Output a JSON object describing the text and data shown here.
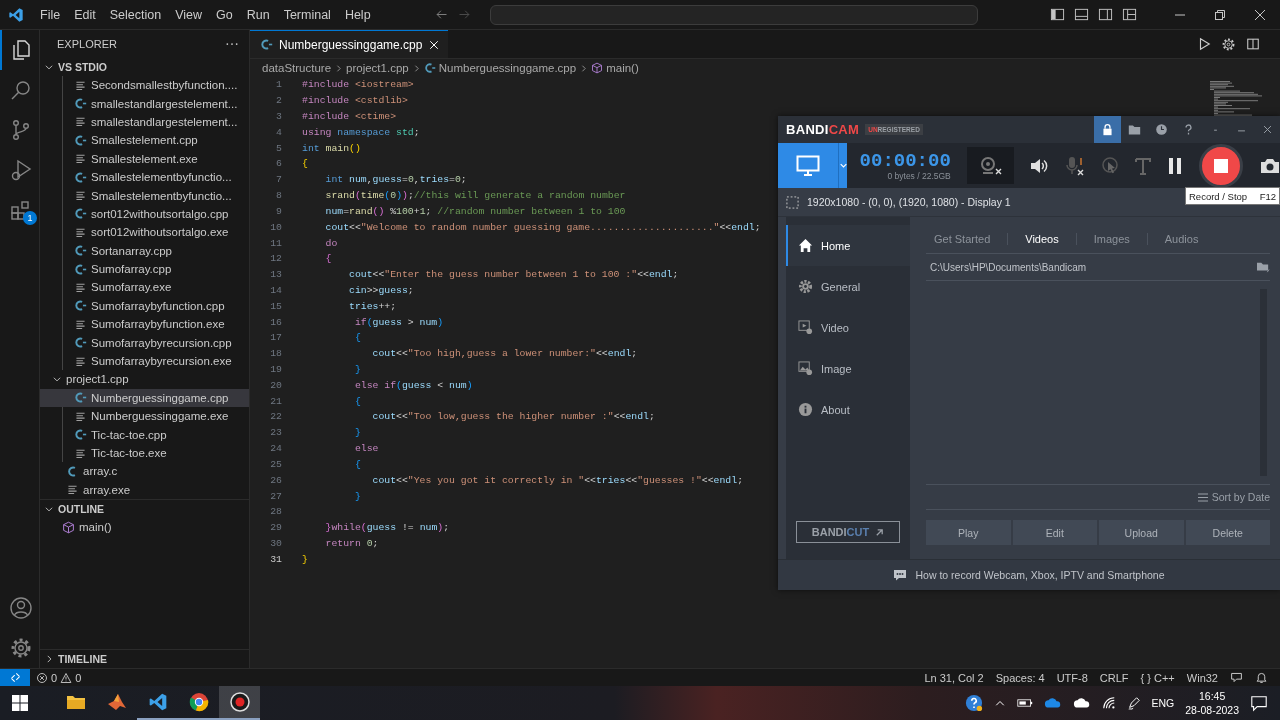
{
  "menu": [
    "File",
    "Edit",
    "Selection",
    "View",
    "Go",
    "Run",
    "Terminal",
    "Help"
  ],
  "activity_bar": {
    "items": [
      {
        "kind": "explorer",
        "selected": true
      },
      {
        "kind": "search",
        "selected": false
      },
      {
        "kind": "source-control",
        "selected": false
      },
      {
        "kind": "run-debug",
        "selected": false
      },
      {
        "kind": "extensions",
        "selected": false,
        "badge": "1"
      }
    ]
  },
  "sidebar": {
    "title": "EXPLORER",
    "workspace": {
      "label": "VS STDIO",
      "expanded": true,
      "children": [
        {
          "kind": "folder",
          "expanded": true,
          "children": [
            {
              "label": "Secondsmallestbyfunction....",
              "kind": "exe",
              "selected": false
            },
            {
              "label": "smallestandlargestelement...",
              "kind": "cpp",
              "selected": false
            },
            {
              "label": "smallestandlargestelement...",
              "kind": "exe",
              "selected": false
            },
            {
              "label": "Smallestelement.cpp",
              "kind": "cpp",
              "selected": false
            },
            {
              "label": "Smallestelement.exe",
              "kind": "exe",
              "selected": false
            },
            {
              "label": "Smallestelementbyfunctio...",
              "kind": "cpp",
              "selected": false
            },
            {
              "label": "Smallestelementbyfunctio...",
              "kind": "exe",
              "selected": false
            },
            {
              "label": "sort012withoutsortalgo.cpp",
              "kind": "cpp",
              "selected": false
            },
            {
              "label": "sort012withoutsortalgo.exe",
              "kind": "exe",
              "selected": false
            },
            {
              "label": "Sortanarray.cpp",
              "kind": "cpp",
              "selected": false
            },
            {
              "label": "Sumofarray.cpp",
              "kind": "cpp",
              "selected": false
            },
            {
              "label": "Sumofarray.exe",
              "kind": "exe",
              "selected": false
            },
            {
              "label": "Sumofarraybyfunction.cpp",
              "kind": "cpp",
              "selected": false
            },
            {
              "label": "Sumofarraybyfunction.exe",
              "kind": "exe",
              "selected": false
            },
            {
              "label": "Sumofarraybyrecursion.cpp",
              "kind": "cpp",
              "selected": false
            },
            {
              "label": "Sumofarraybyrecursion.exe",
              "kind": "exe",
              "selected": false
            }
          ]
        },
        {
          "label": "project1.cpp",
          "kind": "folder",
          "expanded": true,
          "children": [
            {
              "label": "Numberguessinggame.cpp",
              "kind": "cpp",
              "selected": true
            },
            {
              "label": "Numberguessinggame.exe",
              "kind": "exe",
              "selected": false
            },
            {
              "label": "Tic-tac-toe.cpp",
              "kind": "cpp",
              "selected": false
            },
            {
              "label": "Tic-tac-toe.exe",
              "kind": "exe",
              "selected": false
            }
          ]
        },
        {
          "label": "array.c",
          "kind": "c",
          "selected": false
        },
        {
          "label": "array.exe",
          "kind": "exe",
          "selected": false
        }
      ]
    },
    "outline": {
      "label": "OUTLINE",
      "expanded": true,
      "children": [
        {
          "label": "main()"
        }
      ]
    },
    "timeline": {
      "label": "TIMELINE",
      "expanded": false
    }
  },
  "editor": {
    "tabs": [
      {
        "label": "Numberguessinggame.cpp",
        "selected": true
      }
    ],
    "breadcrumb": [
      {
        "label": "dataStructure",
        "kind": "folder"
      },
      {
        "label": "project1.cpp",
        "kind": "folder"
      },
      {
        "label": "Numberguessinggame.cpp",
        "kind": "cpp"
      },
      {
        "label": "main()",
        "kind": "function"
      }
    ],
    "lines": [
      {
        "number": "1",
        "current": false,
        "tokens": [
          {
            "kind": "directive",
            "text": "#include"
          },
          {
            "kind": "string",
            "text": " <iostream>"
          }
        ]
      },
      {
        "number": "2",
        "current": false,
        "tokens": [
          {
            "kind": "directive",
            "text": "#include"
          },
          {
            "kind": "string",
            "text": " <cstdlib>"
          }
        ]
      },
      {
        "number": "3",
        "current": false,
        "tokens": [
          {
            "kind": "directive",
            "text": "#include"
          },
          {
            "kind": "string",
            "text": " <ctime>"
          }
        ]
      },
      {
        "number": "4",
        "current": false,
        "tokens": [
          {
            "kind": "directive",
            "text": "using"
          },
          {
            "kind": "keyword",
            "text": " namespace"
          },
          {
            "kind": "type",
            "text": " std"
          },
          {
            "kind": "plain",
            "text": ";"
          }
        ]
      },
      {
        "number": "5",
        "current": false,
        "tokens": [
          {
            "kind": "keyword",
            "text": "int"
          },
          {
            "kind": "function",
            "text": " main"
          },
          {
            "kind": "bracket1",
            "text": "()"
          }
        ]
      },
      {
        "number": "6",
        "current": false,
        "tokens": [
          {
            "kind": "bracket1",
            "text": "{"
          }
        ]
      },
      {
        "number": "7",
        "current": false,
        "tokens": [
          {
            "kind": "keyword",
            "text": "    int"
          },
          {
            "kind": "variable",
            "text": " num"
          },
          {
            "kind": "plain",
            "text": ","
          },
          {
            "kind": "variable",
            "text": "guess"
          },
          {
            "kind": "plain",
            "text": "="
          },
          {
            "kind": "number",
            "text": "0"
          },
          {
            "kind": "plain",
            "text": ","
          },
          {
            "kind": "variable",
            "text": "tries"
          },
          {
            "kind": "plain",
            "text": "="
          },
          {
            "kind": "number",
            "text": "0"
          },
          {
            "kind": "plain",
            "text": ";"
          }
        ]
      },
      {
        "number": "8",
        "current": false,
        "tokens": [
          {
            "kind": "function",
            "text": "    srand"
          },
          {
            "kind": "bracket2",
            "text": "("
          },
          {
            "kind": "function",
            "text": "time"
          },
          {
            "kind": "bracket3",
            "text": "("
          },
          {
            "kind": "number",
            "text": "0"
          },
          {
            "kind": "bracket3",
            "text": ")"
          },
          {
            "kind": "bracket2",
            "text": ")"
          },
          {
            "kind": "plain",
            "text": ";"
          },
          {
            "kind": "comment",
            "text": "//this will generate a random number"
          }
        ]
      },
      {
        "number": "9",
        "current": false,
        "tokens": [
          {
            "kind": "variable",
            "text": "    num"
          },
          {
            "kind": "plain",
            "text": "="
          },
          {
            "kind": "function",
            "text": "rand"
          },
          {
            "kind": "bracket2",
            "text": "()"
          },
          {
            "kind": "plain",
            "text": " %"
          },
          {
            "kind": "number",
            "text": "100"
          },
          {
            "kind": "plain",
            "text": "+"
          },
          {
            "kind": "number",
            "text": "1"
          },
          {
            "kind": "plain",
            "text": "; "
          },
          {
            "kind": "comment",
            "text": "//random number between 1 to 100"
          }
        ]
      },
      {
        "number": "10",
        "current": false,
        "tokens": [
          {
            "kind": "variable",
            "text": "    cout"
          },
          {
            "kind": "plain",
            "text": "<<"
          },
          {
            "kind": "string",
            "text": "\"Welcome to random number guessing game.....................\""
          },
          {
            "kind": "plain",
            "text": "<<"
          },
          {
            "kind": "variable",
            "text": "endl"
          },
          {
            "kind": "plain",
            "text": ";"
          }
        ]
      },
      {
        "number": "11",
        "current": false,
        "tokens": [
          {
            "kind": "directive",
            "text": "    do"
          }
        ]
      },
      {
        "number": "12",
        "current": false,
        "tokens": [
          {
            "kind": "bracket2",
            "text": "    {"
          }
        ]
      },
      {
        "number": "13",
        "current": false,
        "tokens": [
          {
            "kind": "variable",
            "text": "        cout"
          },
          {
            "kind": "plain",
            "text": "<<"
          },
          {
            "kind": "string",
            "text": "\"Enter the guess number between 1 to 100 :\""
          },
          {
            "kind": "plain",
            "text": "<<"
          },
          {
            "kind": "variable",
            "text": "endl"
          },
          {
            "kind": "plain",
            "text": ";"
          }
        ]
      },
      {
        "number": "14",
        "current": false,
        "tokens": [
          {
            "kind": "variable",
            "text": "        cin"
          },
          {
            "kind": "plain",
            "text": ">>"
          },
          {
            "kind": "variable",
            "text": "guess"
          },
          {
            "kind": "plain",
            "text": ";"
          }
        ]
      },
      {
        "number": "15",
        "current": false,
        "tokens": [
          {
            "kind": "variable",
            "text": "        tries"
          },
          {
            "kind": "plain",
            "text": "++;"
          }
        ]
      },
      {
        "number": "16",
        "current": false,
        "tokens": [
          {
            "kind": "directive",
            "text": "         if"
          },
          {
            "kind": "bracket3",
            "text": "("
          },
          {
            "kind": "variable",
            "text": "guess"
          },
          {
            "kind": "plain",
            "text": " > "
          },
          {
            "kind": "variable",
            "text": "num"
          },
          {
            "kind": "bracket3",
            "text": ")"
          }
        ]
      },
      {
        "number": "17",
        "current": false,
        "tokens": [
          {
            "kind": "bracket3",
            "text": "         {"
          }
        ]
      },
      {
        "number": "18",
        "current": false,
        "tokens": [
          {
            "kind": "variable",
            "text": "            cout"
          },
          {
            "kind": "plain",
            "text": "<<"
          },
          {
            "kind": "string",
            "text": "\"Too high,guess a lower number:\""
          },
          {
            "kind": "plain",
            "text": "<<"
          },
          {
            "kind": "variable",
            "text": "endl"
          },
          {
            "kind": "plain",
            "text": ";"
          }
        ]
      },
      {
        "number": "19",
        "current": false,
        "tokens": [
          {
            "kind": "bracket3",
            "text": "         }"
          }
        ]
      },
      {
        "number": "20",
        "current": false,
        "tokens": [
          {
            "kind": "directive",
            "text": "         else if"
          },
          {
            "kind": "bracket3",
            "text": "("
          },
          {
            "kind": "variable",
            "text": "guess"
          },
          {
            "kind": "plain",
            "text": " < "
          },
          {
            "kind": "variable",
            "text": "num"
          },
          {
            "kind": "bracket3",
            "text": ")"
          }
        ]
      },
      {
        "number": "21",
        "current": false,
        "tokens": [
          {
            "kind": "bracket3",
            "text": "         {"
          }
        ]
      },
      {
        "number": "22",
        "current": false,
        "tokens": [
          {
            "kind": "variable",
            "text": "            cout"
          },
          {
            "kind": "plain",
            "text": "<<"
          },
          {
            "kind": "string",
            "text": "\"Too low,guess the higher number :\""
          },
          {
            "kind": "plain",
            "text": "<<"
          },
          {
            "kind": "variable",
            "text": "endl"
          },
          {
            "kind": "plain",
            "text": ";"
          }
        ]
      },
      {
        "number": "23",
        "current": false,
        "tokens": [
          {
            "kind": "bracket3",
            "text": "         }"
          }
        ]
      },
      {
        "number": "24",
        "current": false,
        "tokens": [
          {
            "kind": "directive",
            "text": "         else"
          }
        ]
      },
      {
        "number": "25",
        "current": false,
        "tokens": [
          {
            "kind": "bracket3",
            "text": "         {"
          }
        ]
      },
      {
        "number": "26",
        "current": false,
        "tokens": [
          {
            "kind": "variable",
            "text": "            cout"
          },
          {
            "kind": "plain",
            "text": "<<"
          },
          {
            "kind": "string",
            "text": "\"Yes you got it correctly in \""
          },
          {
            "kind": "plain",
            "text": "<<"
          },
          {
            "kind": "variable",
            "text": "tries"
          },
          {
            "kind": "plain",
            "text": "<<"
          },
          {
            "kind": "string",
            "text": "\"guesses !\""
          },
          {
            "kind": "plain",
            "text": "<<"
          },
          {
            "kind": "variable",
            "text": "endl"
          },
          {
            "kind": "plain",
            "text": ";"
          }
        ]
      },
      {
        "number": "27",
        "current": false,
        "tokens": [
          {
            "kind": "bracket3",
            "text": "         }"
          }
        ]
      },
      {
        "number": "28",
        "current": false
      },
      {
        "number": "29",
        "current": false,
        "tokens": [
          {
            "kind": "bracket2",
            "text": "    }"
          },
          {
            "kind": "directive",
            "text": "while"
          },
          {
            "kind": "bracket2",
            "text": "("
          },
          {
            "kind": "variable",
            "text": "guess"
          },
          {
            "kind": "plain",
            "text": " != "
          },
          {
            "kind": "variable",
            "text": "num"
          },
          {
            "kind": "bracket2",
            "text": ")"
          },
          {
            "kind": "plain",
            "text": ";"
          }
        ]
      },
      {
        "number": "30",
        "current": false,
        "tokens": [
          {
            "kind": "directive",
            "text": "    return"
          },
          {
            "kind": "number",
            "text": " 0"
          },
          {
            "kind": "plain",
            "text": ";"
          }
        ]
      },
      {
        "number": "31",
        "current": true,
        "tokens": [
          {
            "kind": "bracket1",
            "text": "}"
          }
        ]
      }
    ]
  },
  "status_bar": {
    "errors": "0",
    "warnings": "0",
    "items": [
      "Ln 31, Col 2",
      "Spaces: 4",
      "UTF-8",
      "CRLF",
      "{ } C++",
      "Win32"
    ]
  },
  "bandicam": {
    "logo": [
      "BANDI",
      "CAM"
    ],
    "badge": [
      "UN",
      "REGISTERED"
    ],
    "title_buttons": [
      {
        "kind": "lock",
        "selected": true
      },
      {
        "kind": "folder",
        "selected": false
      },
      {
        "kind": "history",
        "selected": false
      },
      {
        "kind": "help",
        "selected": false
      }
    ],
    "timer": "00:00:00",
    "storage": "0 bytes / 22.5GB",
    "tooltip": {
      "label": "Record / Stop",
      "shortcut": "F12"
    },
    "area": "1920x1080 - (0, 0), (1920, 1080) - Display 1",
    "nav": [
      {
        "label": "Home",
        "kind": "home",
        "selected": true
      },
      {
        "label": "General",
        "kind": "general",
        "selected": false
      },
      {
        "label": "Video",
        "kind": "video",
        "selected": false
      },
      {
        "label": "Image",
        "kind": "image",
        "selected": false
      },
      {
        "label": "About",
        "kind": "about",
        "selected": false
      }
    ],
    "bandicut": [
      "BANDI",
      "CUT"
    ],
    "tabs": [
      {
        "label": "Get Started",
        "selected": false
      },
      {
        "label": "Videos",
        "selected": true
      },
      {
        "label": "Images",
        "selected": false
      },
      {
        "label": "Audios",
        "selected": false
      }
    ],
    "path": "C:\\Users\\HP\\Documents\\Bandicam",
    "sort": "Sort by Date",
    "buttons": [
      "Play",
      "Edit",
      "Upload",
      "Delete"
    ],
    "footer": "How to record Webcam, Xbox, IPTV and Smartphone"
  },
  "taskbar": {
    "apps": [
      {
        "kind": "file-explorer",
        "running": false,
        "selected": false
      },
      {
        "kind": "matlab",
        "running": false,
        "selected": false
      },
      {
        "kind": "vscode",
        "running": true,
        "selected": false
      },
      {
        "kind": "chrome",
        "running": true,
        "selected": false
      },
      {
        "kind": "bandicam",
        "running": true,
        "selected": true
      }
    ],
    "language": "ENG",
    "time": "16:45",
    "date": "28-08-2023"
  }
}
